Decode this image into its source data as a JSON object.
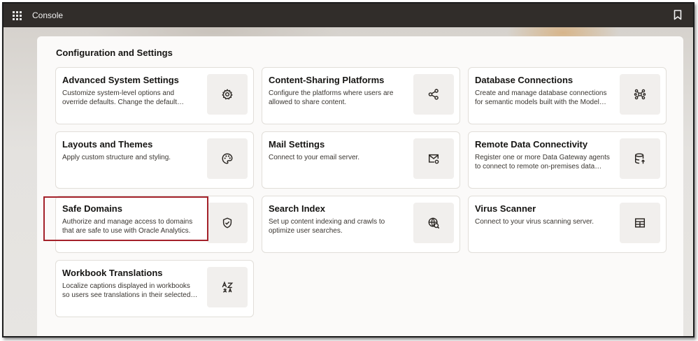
{
  "header": {
    "app_title": "Console",
    "menu_icon": "grid-menu-icon",
    "bookmark_icon": "bookmark-icon"
  },
  "section": {
    "title": "Configuration and Settings"
  },
  "cards": [
    {
      "title": "Advanced System Settings",
      "desc": "Customize system-level options and override defaults. Change the default…",
      "icon": "gear-icon"
    },
    {
      "title": "Content-Sharing Platforms",
      "desc": "Configure the platforms where users are allowed to share content.",
      "icon": "share-icon"
    },
    {
      "title": "Database Connections",
      "desc": "Create and manage database connections for semantic models built with the Model…",
      "icon": "network-icon"
    },
    {
      "title": "Layouts and Themes",
      "desc": "Apply custom structure and styling.",
      "icon": "palette-icon"
    },
    {
      "title": "Mail Settings",
      "desc": "Connect to your email server.",
      "icon": "mail-settings-icon"
    },
    {
      "title": "Remote Data Connectivity",
      "desc": "Register one or more Data Gateway agents to connect to remote on-premises data…",
      "icon": "database-upload-icon"
    },
    {
      "title": "Safe Domains",
      "desc": "Authorize and manage access to domains that are safe to use with Oracle Analytics.",
      "icon": "shield-check-icon"
    },
    {
      "title": "Search Index",
      "desc": "Set up content indexing and crawls to optimize user searches.",
      "icon": "globe-search-icon"
    },
    {
      "title": "Virus Scanner",
      "desc": "Connect to your virus scanning server.",
      "icon": "grid-table-icon"
    },
    {
      "title": "Workbook Translations",
      "desc": "Localize captions displayed in workbooks so users see translations in their selected…",
      "icon": "translate-icon"
    }
  ],
  "colors": {
    "topbar": "#312d2a",
    "panel": "#fbfaf9",
    "highlight_border": "#a4212a",
    "icon_stroke": "#2a2622"
  }
}
